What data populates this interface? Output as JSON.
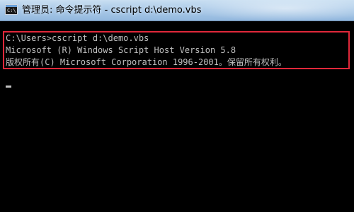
{
  "window": {
    "title": "管理员: 命令提示符 - cscript  d:\\demo.vbs",
    "icon": "cmd-icon",
    "icon_glyph": "C:\\"
  },
  "console": {
    "lines": [
      "C:\\Users>cscript d:\\demo.vbs",
      "Microsoft (R) Windows Script Host Version 5.8",
      "版权所有(C) Microsoft Corporation 1996-2001。保留所有权利。"
    ],
    "text_color": "#c0c0c0",
    "background": "#000000",
    "highlight_color": "#e0283a"
  }
}
